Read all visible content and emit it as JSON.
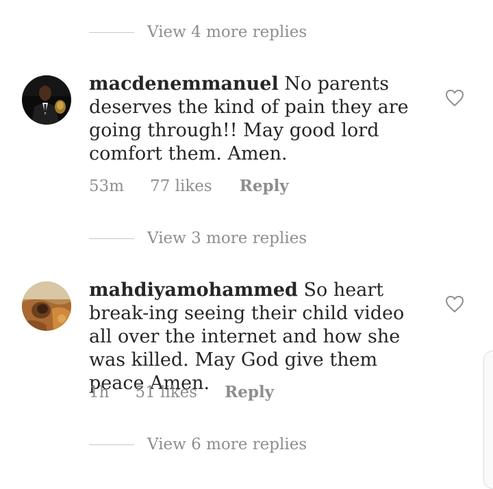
{
  "thread": {
    "top_view_replies": "View 4 more replies",
    "bottom_view_replies": "View 6 more replies"
  },
  "comments": [
    {
      "username": "macdenemmanuel",
      "text": "No parents deserves the kind of pain they are going through!! May good lord comfort them. Amen.",
      "time": "53m",
      "likes": "77 likes",
      "reply": "Reply",
      "view_replies": "View 3 more replies",
      "avatar_icon": "profile-photo-man-in-suit",
      "heart_icon": "heart-outline-icon"
    },
    {
      "username": "mahdiyamohammed",
      "text": "So heart break-ing seeing their child video all over the internet and how she was killed. May God give them peace Amen.",
      "time": "1h",
      "likes": "51 likes",
      "reply": "Reply",
      "avatar_icon": "profile-photo-illustration",
      "heart_icon": "heart-outline-icon"
    }
  ],
  "colors": {
    "text": "#262626",
    "secondary": "#8e8e8e",
    "divider": "#c7c7c7",
    "background": "#ffffff"
  }
}
